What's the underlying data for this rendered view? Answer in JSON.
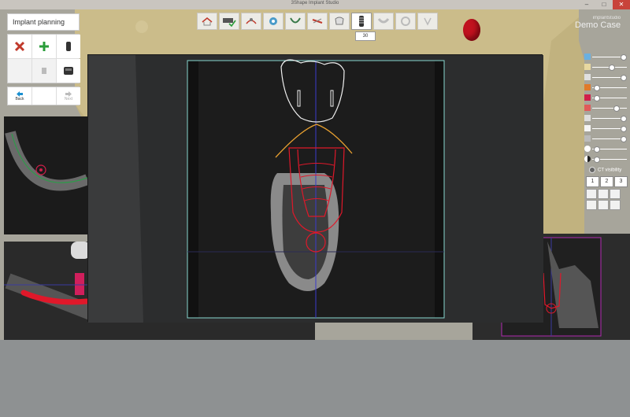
{
  "window": {
    "title": "3Shape Implant Studio",
    "minimize": "–",
    "maximize": "□",
    "close": "✕"
  },
  "toolbar": {
    "buttons": [
      {
        "icon": "home-icon"
      },
      {
        "icon": "scan-check-icon"
      },
      {
        "icon": "nerve-icon"
      },
      {
        "icon": "tooth-settings-icon"
      },
      {
        "icon": "jaw-icon"
      },
      {
        "icon": "crown-design-icon"
      },
      {
        "icon": "crown-icon"
      },
      {
        "icon": "implant-icon",
        "active": true
      },
      {
        "icon": "guide-icon"
      },
      {
        "icon": "sleeve-icon"
      },
      {
        "icon": "export-icon"
      }
    ],
    "tooltip": "30"
  },
  "case": {
    "name": "implantstudio",
    "case_label": "Demo Case"
  },
  "left_panel": {
    "title": "Implant planning",
    "tools": [
      {
        "icon": "delete-icon"
      },
      {
        "icon": "add-implant-icon"
      },
      {
        "icon": "implant-small-icon"
      },
      {
        "icon": "empty-icon"
      },
      {
        "icon": "abutment-icon"
      },
      {
        "icon": "sleeve-cylinder-icon"
      }
    ],
    "back_label": "Back",
    "next_label": "Next"
  },
  "right_panel": {
    "ct_visibility_label": "CT visibility",
    "view_tabs": [
      "1",
      "2",
      "3"
    ],
    "sliders": [
      {
        "icon": "scan-icon",
        "value": 0.95
      },
      {
        "icon": "tooth-icon",
        "value": 0.55
      },
      {
        "icon": "crown-icon",
        "value": 0.95
      },
      {
        "icon": "implant-icon",
        "value": 0.05
      },
      {
        "icon": "sleeve-icon",
        "value": 0.05
      },
      {
        "icon": "ct-icon",
        "value": 0.7
      },
      {
        "icon": "jaw-icon",
        "value": 0.95
      },
      {
        "icon": "tooth-outline-icon",
        "value": 0.95
      },
      {
        "icon": "nerve-icon",
        "value": 0.95
      },
      {
        "icon": "brightness-icon",
        "value": 0.05
      },
      {
        "icon": "contrast-icon",
        "value": 0.05
      }
    ]
  }
}
